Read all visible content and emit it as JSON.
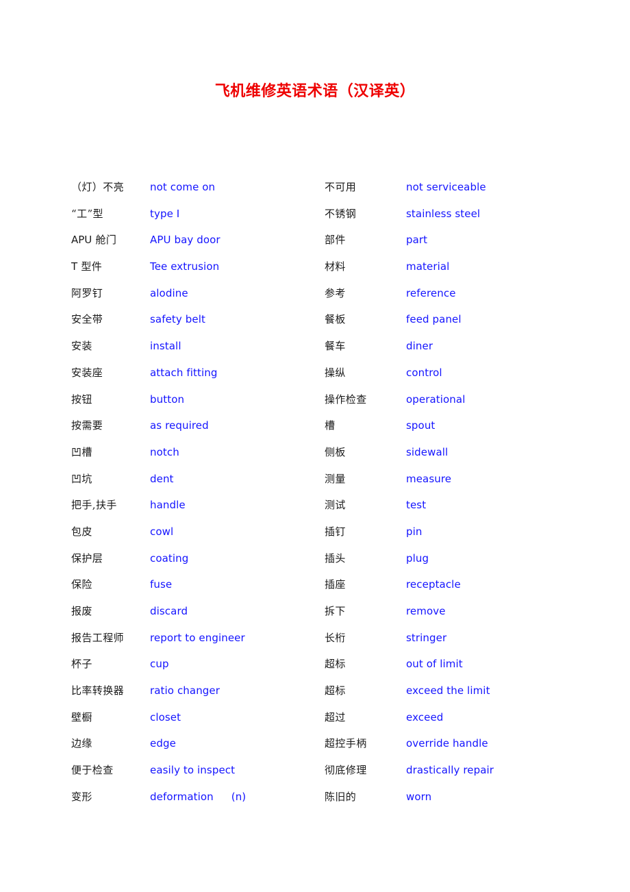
{
  "document": {
    "title": "飞机维修英语术语（汉译英）",
    "title_color": "#ee0000",
    "term_color": "#1a1a1a",
    "gloss_color": "#1414ff",
    "background_color": "#ffffff"
  },
  "glossary": {
    "left_column": [
      {
        "term": "（灯）不亮",
        "gloss": "not come on"
      },
      {
        "term": "“工”型",
        "gloss": "type I"
      },
      {
        "term": "APU 舱门",
        "term_latin": "APU",
        "term_rest": " 舱门",
        "gloss": "APU bay door"
      },
      {
        "term": "T 型件",
        "term_latin": "T",
        "term_rest": " 型件",
        "gloss": "Tee extrusion"
      },
      {
        "term": "阿罗钉",
        "gloss": "alodine"
      },
      {
        "term": "安全带",
        "gloss": "safety belt"
      },
      {
        "term": "安装",
        "gloss": "install"
      },
      {
        "term": "安装座",
        "gloss": "attach fitting"
      },
      {
        "term": "按钮",
        "gloss": "button"
      },
      {
        "term": "按需要",
        "gloss": "as required"
      },
      {
        "term": "凹槽",
        "gloss": "notch"
      },
      {
        "term": "凹坑",
        "gloss": "dent"
      },
      {
        "term": "把手,扶手",
        "gloss": "handle"
      },
      {
        "term": "包皮",
        "gloss": "cowl"
      },
      {
        "term": "保护层",
        "gloss": "coating"
      },
      {
        "term": "保险",
        "gloss": "fuse"
      },
      {
        "term": "报废",
        "gloss": "discard"
      },
      {
        "term": "报告工程师",
        "gloss": "report to engineer"
      },
      {
        "term": "杯子",
        "gloss": "cup"
      },
      {
        "term": "比率转换器",
        "gloss": "ratio changer"
      },
      {
        "term": "壁橱",
        "gloss": "closet"
      },
      {
        "term": "边缘",
        "gloss": "edge"
      },
      {
        "term": "便于检查",
        "gloss": "easily to inspect"
      },
      {
        "term": "变形",
        "gloss": "deformation",
        "pos": "(n)"
      }
    ],
    "right_column": [
      {
        "term": "不可用",
        "gloss": "not serviceable"
      },
      {
        "term": "不锈钢",
        "gloss": "stainless steel"
      },
      {
        "term": "部件",
        "gloss": "part"
      },
      {
        "term": "材料",
        "gloss": "material"
      },
      {
        "term": "参考",
        "gloss": "reference"
      },
      {
        "term": "餐板",
        "gloss": "feed panel"
      },
      {
        "term": "餐车",
        "gloss": "diner"
      },
      {
        "term": "操纵",
        "gloss": "control"
      },
      {
        "term": "操作检查",
        "gloss": "operational"
      },
      {
        "term": "槽",
        "gloss": "spout"
      },
      {
        "term": "侧板",
        "gloss": "sidewall"
      },
      {
        "term": "测量",
        "gloss": "measure"
      },
      {
        "term": "测试",
        "gloss": "test"
      },
      {
        "term": "插钉",
        "gloss": "pin"
      },
      {
        "term": "插头",
        "gloss": "plug"
      },
      {
        "term": "插座",
        "gloss": "receptacle"
      },
      {
        "term": "拆下",
        "gloss": "remove"
      },
      {
        "term": "长桁",
        "gloss": "stringer"
      },
      {
        "term": "超标",
        "gloss": "out of limit"
      },
      {
        "term": "超标",
        "gloss": "exceed the limit"
      },
      {
        "term": "超过",
        "gloss": "exceed"
      },
      {
        "term": "超控手柄",
        "gloss": "override handle"
      },
      {
        "term": "彻底修理",
        "gloss": "drastically repair"
      },
      {
        "term": "陈旧的",
        "gloss": "worn"
      }
    ]
  }
}
